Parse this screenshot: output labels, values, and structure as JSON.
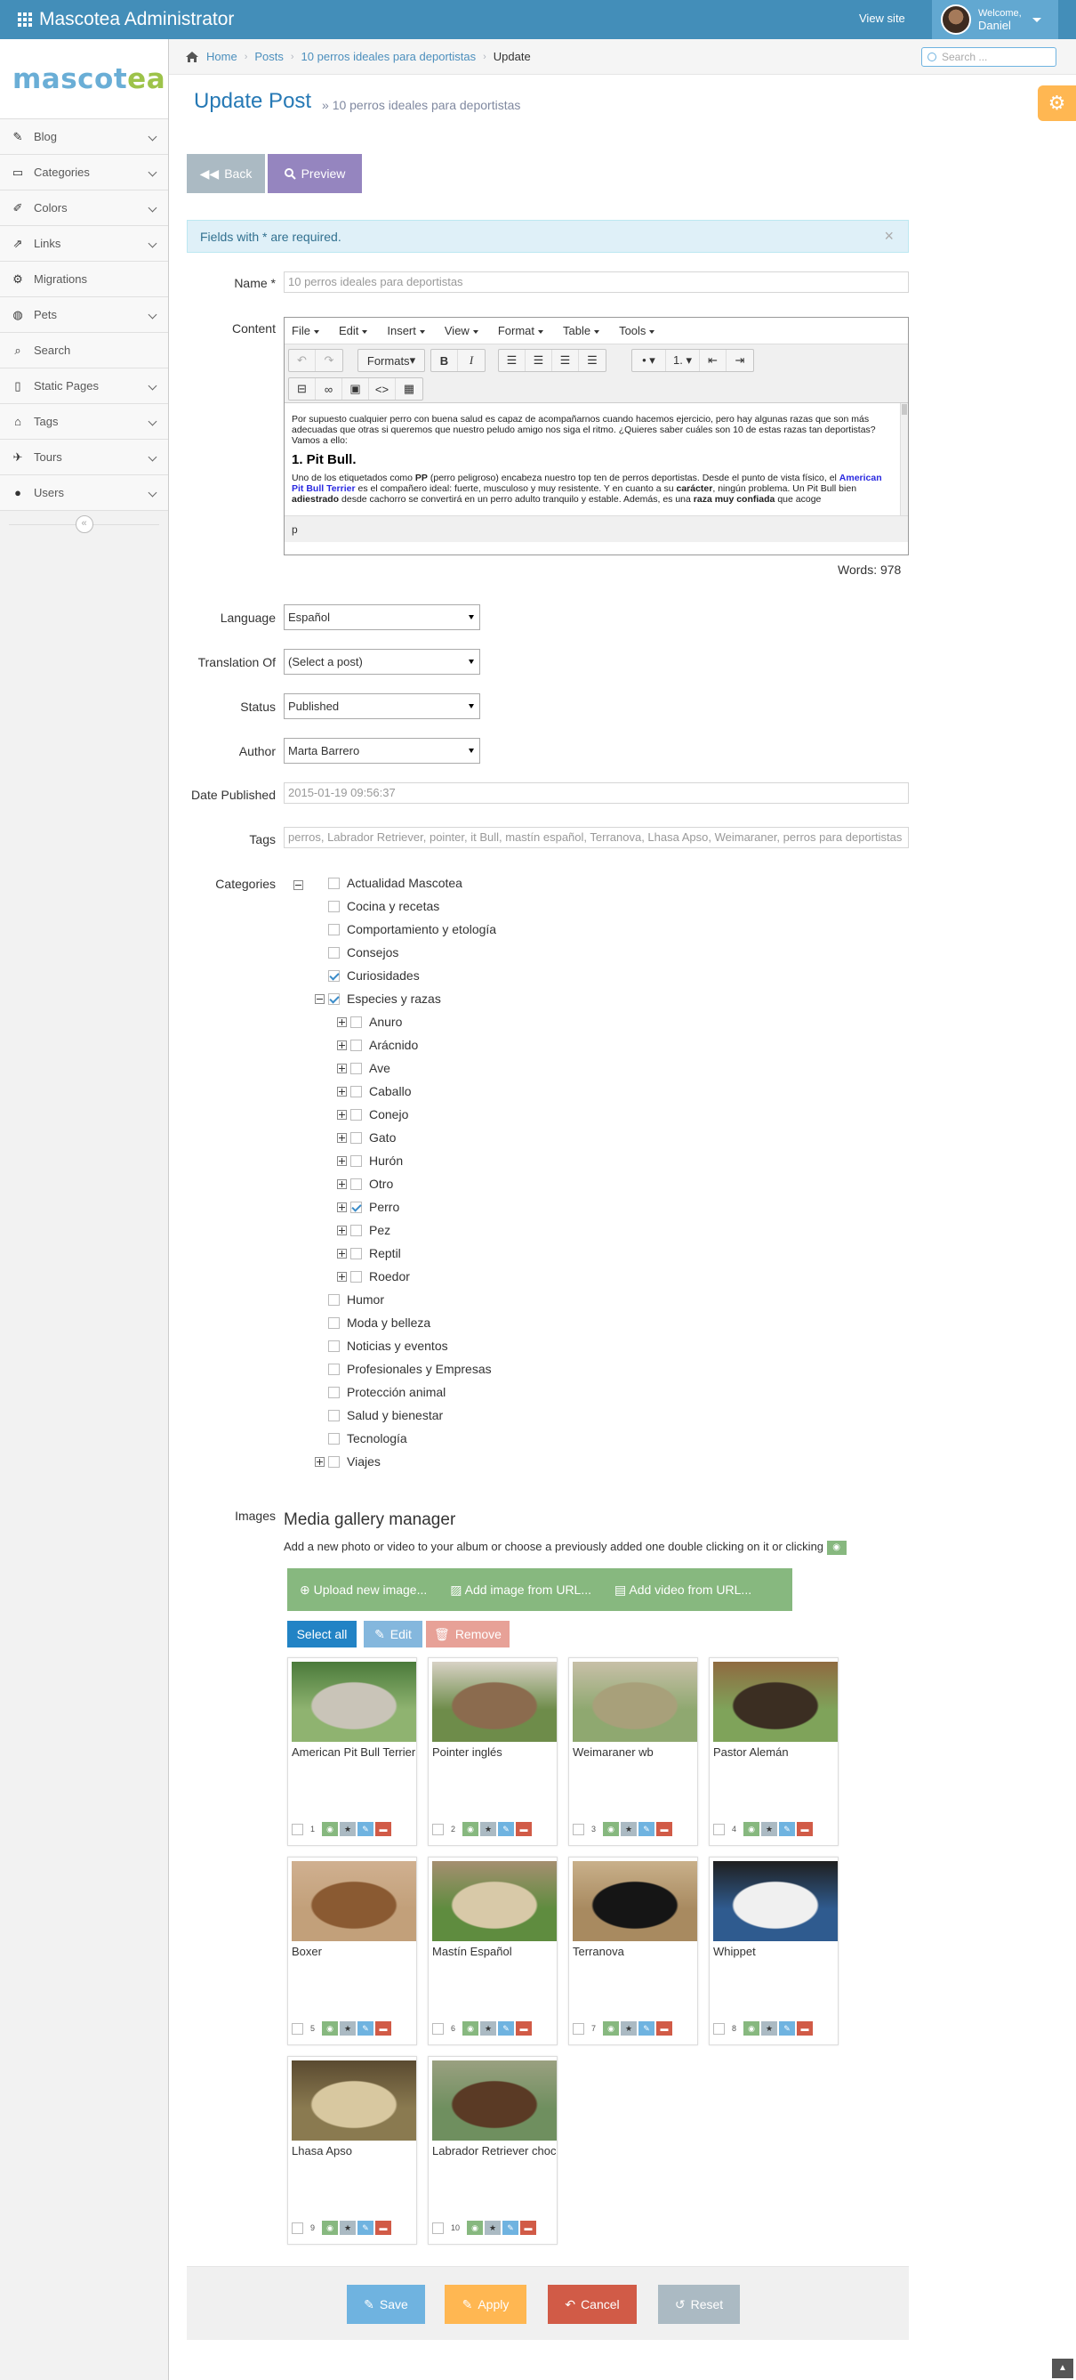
{
  "topbar": {
    "app_title": "Mascotea Administrator",
    "view_site": "View site",
    "welcome": "Welcome,",
    "user_name": "Daniel"
  },
  "logo": {
    "part1": "mascot",
    "part2": "ea"
  },
  "sidebar": {
    "items": [
      {
        "label": "Blog",
        "icon": "pencil-square-icon"
      },
      {
        "label": "Categories",
        "icon": "folder-icon"
      },
      {
        "label": "Colors",
        "icon": "paint-brush-icon"
      },
      {
        "label": "Links",
        "icon": "external-link-icon"
      },
      {
        "label": "Migrations",
        "icon": "gear-icon"
      },
      {
        "label": "Pets",
        "icon": "globe-icon"
      },
      {
        "label": "Search",
        "icon": "search-icon"
      },
      {
        "label": "Static Pages",
        "icon": "file-icon"
      },
      {
        "label": "Tags",
        "icon": "tags-icon"
      },
      {
        "label": "Tours",
        "icon": "plane-icon"
      },
      {
        "label": "Users",
        "icon": "user-icon"
      }
    ]
  },
  "breadcrumb": {
    "home": "Home",
    "posts": "Posts",
    "post": "10 perros ideales para deportistas",
    "current": "Update"
  },
  "search": {
    "placeholder": "Search ..."
  },
  "header": {
    "title": "Update Post",
    "subtitle": "10 perros ideales para deportistas"
  },
  "actions": {
    "back": "Back",
    "preview": "Preview"
  },
  "alert": {
    "text": "Fields with * are required.",
    "close": "×"
  },
  "form": {
    "name_label": "Name *",
    "name_value": "10 perros ideales para deportistas",
    "content_label": "Content",
    "language_label": "Language",
    "language_value": "Español",
    "translation_label": "Translation Of",
    "translation_value": "(Select a post)",
    "status_label": "Status",
    "status_value": "Published",
    "author_label": "Author",
    "author_value": "Marta Barrero",
    "date_label": "Date Published",
    "date_value": "2015-01-19 09:56:37",
    "tags_label": "Tags",
    "tags_value": "perros, Labrador Retriever, pointer, it Bull, mastín español, Terranova, Lhasa Apso, Weimaraner, perros para deportistas",
    "categories_label": "Categories",
    "images_label": "Images"
  },
  "editor": {
    "menu": [
      "File",
      "Edit",
      "Insert",
      "View",
      "Format",
      "Table",
      "Tools"
    ],
    "formats": "Formats",
    "para1": "Por supuesto cualquier perro con buena salud es capaz de acompañarnos cuando hacemos ejercicio, pero hay algunas razas que son más adecuadas que otras si queremos que nuestro peludo amigo nos siga el ritmo. ¿Quieres saber cuáles son 10 de estas razas tan deportistas? Vamos a ello:",
    "heading": "1. Pit Bull.",
    "para2_a": "Uno de los etiquetados como ",
    "para2_b": "PP",
    "para2_c": " (perro peligroso) encabeza nuestro top ten de perros deportistas. Desde el punto de vista físico, el ",
    "para2_link": "American Pit Bull Terrier",
    "para2_d": " es el compañero ideal: fuerte, musculoso y muy resistente. Y en cuanto a su ",
    "para2_e": "carácter",
    "para2_f": ", ningún problema. Un Pit Bull bien ",
    "para2_g": "adiestrado",
    "para2_h": " desde cachorro se convertirá en un perro adulto tranquilo y estable. Además, es una ",
    "para2_i": "raza muy confiada",
    "para2_j": " que acoge",
    "status_path": "p",
    "words": "Words: 978"
  },
  "categories": {
    "top": [
      {
        "label": "Actualidad Mascotea",
        "checked": false
      },
      {
        "label": "Cocina y recetas",
        "checked": false
      },
      {
        "label": "Comportamiento y etología",
        "checked": false
      },
      {
        "label": "Consejos",
        "checked": false
      },
      {
        "label": "Curiosidades",
        "checked": true
      },
      {
        "label": "Especies y razas",
        "checked": true
      }
    ],
    "species": [
      {
        "label": "Anuro",
        "checked": false
      },
      {
        "label": "Arácnido",
        "checked": false
      },
      {
        "label": "Ave",
        "checked": false
      },
      {
        "label": "Caballo",
        "checked": false
      },
      {
        "label": "Conejo",
        "checked": false
      },
      {
        "label": "Gato",
        "checked": false
      },
      {
        "label": "Hurón",
        "checked": false
      },
      {
        "label": "Otro",
        "checked": false
      },
      {
        "label": "Perro",
        "checked": true
      },
      {
        "label": "Pez",
        "checked": false
      },
      {
        "label": "Reptil",
        "checked": false
      },
      {
        "label": "Roedor",
        "checked": false
      }
    ],
    "rest": [
      {
        "label": "Humor",
        "checked": false
      },
      {
        "label": "Moda y belleza",
        "checked": false
      },
      {
        "label": "Noticias y eventos",
        "checked": false
      },
      {
        "label": "Profesionales y Empresas",
        "checked": false
      },
      {
        "label": "Protección animal",
        "checked": false
      },
      {
        "label": "Salud y bienestar",
        "checked": false
      },
      {
        "label": "Tecnología",
        "checked": false
      },
      {
        "label": "Viajes",
        "checked": false
      }
    ]
  },
  "gallery": {
    "title": "Media gallery manager",
    "description": "Add a new photo or video to your album or choose a previously added one double clicking on it or clicking",
    "upload": "Upload new image...",
    "add_url": "Add image from URL...",
    "add_video": "Add video from URL...",
    "select_all": "Select all",
    "edit": "Edit",
    "remove": "Remove",
    "items": [
      {
        "caption": "American Pit Bull Terrier",
        "num": "1"
      },
      {
        "caption": "Pointer inglés",
        "num": "2"
      },
      {
        "caption": "Weimaraner wb",
        "num": "3"
      },
      {
        "caption": "Pastor Alemán",
        "num": "4"
      },
      {
        "caption": "Boxer",
        "num": "5"
      },
      {
        "caption": "Mastín Español",
        "num": "6"
      },
      {
        "caption": "Terranova",
        "num": "7"
      },
      {
        "caption": "Whippet",
        "num": "8"
      },
      {
        "caption": "Lhasa Apso",
        "num": "9"
      },
      {
        "caption": "Labrador Retriever chocolate",
        "num": "10"
      }
    ]
  },
  "footer_actions": {
    "save": "Save",
    "apply": "Apply",
    "cancel": "Cancel",
    "reset": "Reset"
  },
  "colors": {
    "topbar": "#438eb9",
    "accent": "#2679b5",
    "preview": "#9585bf",
    "success": "#87b87f",
    "danger": "#d15b47",
    "warning": "#ffb752"
  }
}
